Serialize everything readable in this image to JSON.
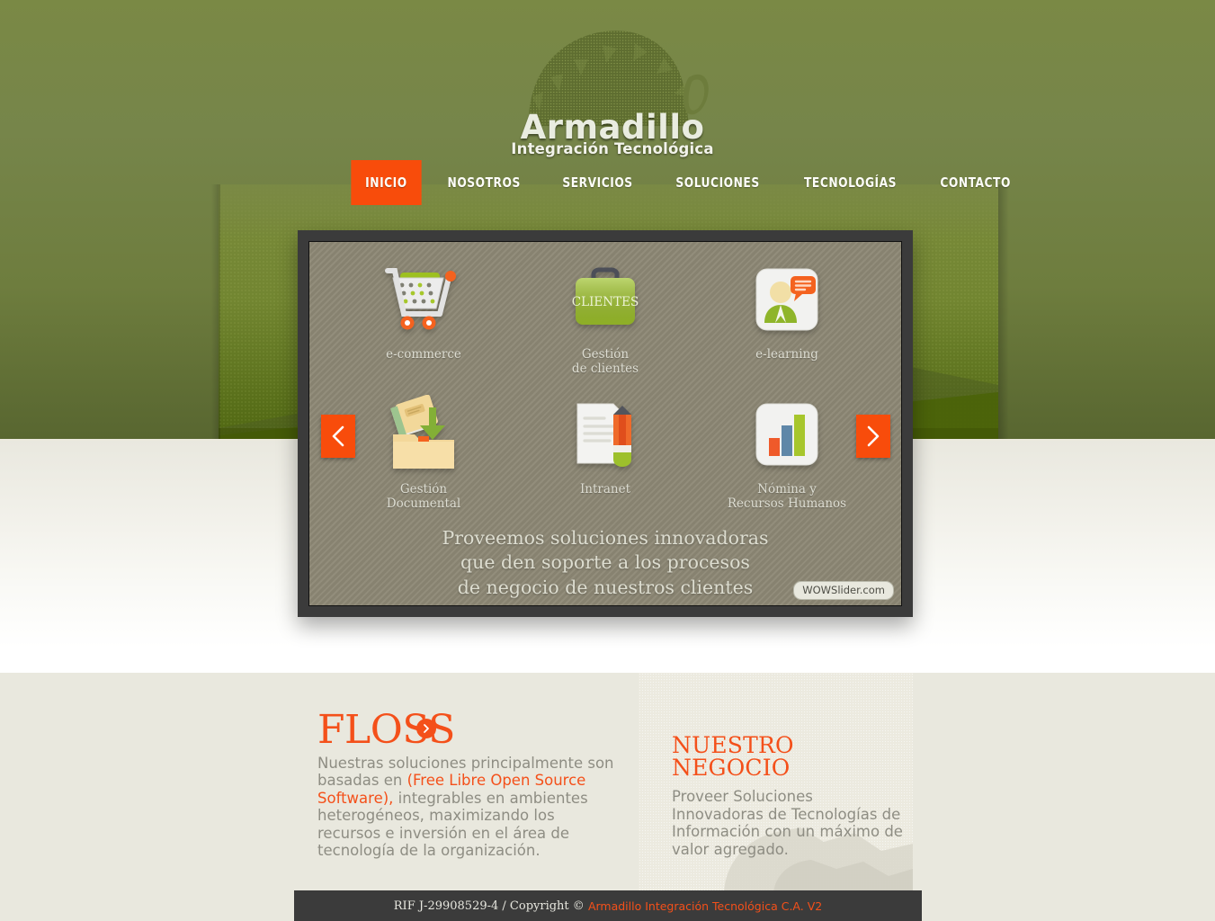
{
  "site": {
    "logo_name": "Armadillo",
    "logo_tagline": "Integración Tecnológica"
  },
  "nav": {
    "items": [
      {
        "label": "INICIO",
        "active": true
      },
      {
        "label": "NOSOTROS",
        "active": false
      },
      {
        "label": "SERVICIOS",
        "active": false
      },
      {
        "label": "SOLUCIONES",
        "active": false
      },
      {
        "label": "TECNOLOGÍAS",
        "active": false
      },
      {
        "label": "CONTACTO",
        "active": false
      }
    ]
  },
  "slider": {
    "prev_label": "‹",
    "next_label": "›",
    "badge": "WOWSlider.com",
    "tagline_line1": "Proveemos soluciones innovadoras",
    "tagline_line2": "que den soporte a los procesos",
    "tagline_line3": "de negocio de nuestros clientes",
    "items": [
      {
        "icon": "shopping-cart-icon",
        "label_line1": "e-commerce",
        "label_line2": ""
      },
      {
        "icon": "briefcase-icon",
        "badge_text": "CLIENTES",
        "label_line1": "Gestión",
        "label_line2": "de clientes"
      },
      {
        "icon": "user-chat-icon",
        "label_line1": "e-learning",
        "label_line2": ""
      },
      {
        "icon": "folder-arrows-icon",
        "label_line1": "Gestión",
        "label_line2": "Documental"
      },
      {
        "icon": "document-pencil-icon",
        "label_line1": "Intranet",
        "label_line2": ""
      },
      {
        "icon": "bar-chart-icon",
        "label_line1": "Nómina y",
        "label_line2": "Recursos Humanos"
      }
    ]
  },
  "content": {
    "floss": {
      "title": "FLOSS",
      "text_part1": "Nuestras soluciones principalmente son basadas en ",
      "text_highlight": "(Free Libre Open Source Software),",
      "text_part2": " integrables en ambientes heterogéneos, maximizando los recursos e inversión en el área de tecnología de la organización."
    },
    "negocio": {
      "title": "NUESTRO NEGOCIO",
      "text": "Proveer Soluciones Innovadoras de Tecnologías de Información con un máximo de valor agregado."
    }
  },
  "footer": {
    "rif_copyright": "RIF J-29908529-4 / Copyright ©",
    "company": "Armadillo Integración Tecnológica C.A. V2"
  },
  "colors": {
    "accent_orange": "#f4501a",
    "nav_active": "#f84c0b",
    "hero_green": "#7a8945",
    "footer_dark": "#3b3b3b",
    "body_text": "#8e8d83"
  }
}
